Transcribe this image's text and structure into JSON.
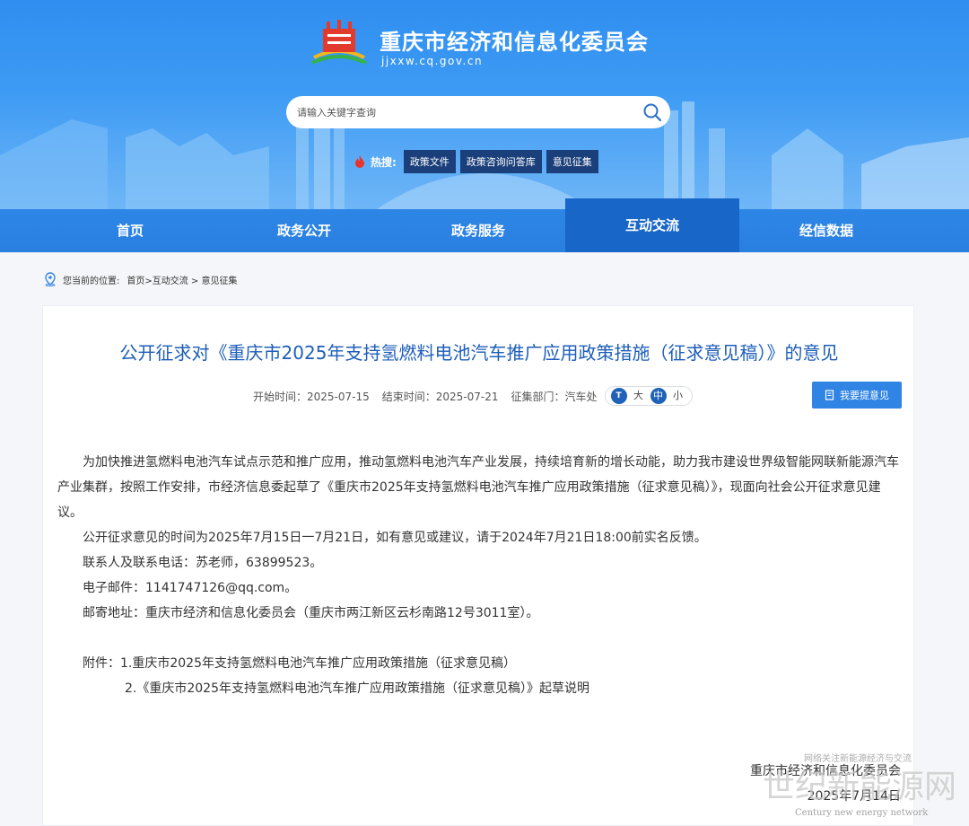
{
  "header": {
    "site_title": "重庆市经济和信息化委员会",
    "site_domain": "jjxxw.cq.gov.cn",
    "search": {
      "placeholder": "请输入关键字查询"
    },
    "hot": {
      "label": "热搜:",
      "tags": [
        "政策文件",
        "政策咨询问答库",
        "意见征集"
      ]
    }
  },
  "nav": {
    "items": [
      "首页",
      "政务公开",
      "政务服务",
      "互动交流",
      "经信数据"
    ],
    "active_index": 3
  },
  "breadcrumb": {
    "prefix": "您当前的位置:",
    "path": "首页>互动交流 > 意见征集"
  },
  "article": {
    "title": "公开征求对《重庆市2025年支持氢燃料电池汽车推广应用政策措施（征求意见稿）》的意见",
    "start": "开始时间：2025-07-15",
    "end": "结束时间：2025-07-21",
    "dept": "征集部门：汽车处",
    "font_sizes": {
      "icon": "T",
      "large": "大",
      "medium": "中",
      "small": "小"
    },
    "feedback_button": "我要提意见",
    "paragraphs": [
      "为加快推进氢燃料电池汽车试点示范和推广应用，推动氢燃料电池汽车产业发展，持续培育新的增长动能，助力我市建设世界级智能网联新能源汽车产业集群，按照工作安排，市经济信息委起草了《重庆市2025年支持氢燃料电池汽车推广应用政策措施（征求意见稿）》，现面向社会公开征求意见建议。",
      "公开征求意见的时间为2025年7月15日一7月21日，如有意见或建议，请于2024年7月21日18:00前实名反馈。",
      "联系人及联系电话：苏老师，63899523。",
      "电子邮件：1141747126@qq.com。",
      "邮寄地址：重庆市经济和信息化委员会（重庆市两江新区云杉南路12号3011室）。"
    ],
    "attachment_1": "附件：1.重庆市2025年支持氢燃料电池汽车推广应用政策措施（征求意见稿）",
    "attachment_2": "2.《重庆市2025年支持氢燃料电池汽车推广应用政策措施（征求意见稿）》起草说明",
    "signature_org": "重庆市经济和信息化委员会",
    "signature_date": "2025年7月14日"
  },
  "watermark": {
    "line1": "网络关注新能源经济与交流",
    "line2": "世纪新能源网",
    "line3": "Century new energy network"
  },
  "colors": {
    "banner": "#3e9bf4",
    "nav": "#2a7fe0",
    "nav_active": "#1866c8",
    "title": "#1e5eb8",
    "button": "#2f84e4",
    "tag": "#1a3f7a"
  }
}
